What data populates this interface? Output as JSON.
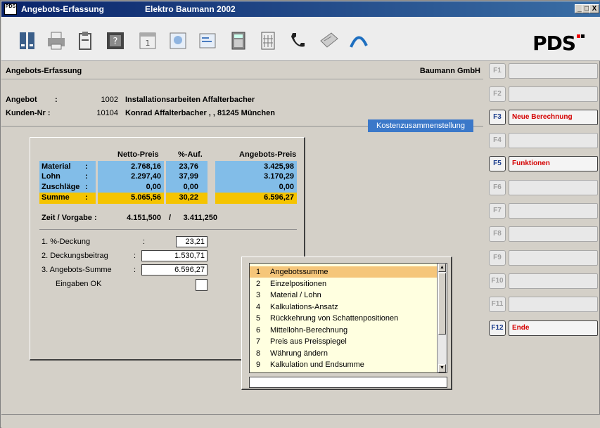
{
  "window": {
    "title": "Angebots-Erfassung",
    "app_name": "Elektro Baumann 2002",
    "app_icon_text": "PDS",
    "buttons": [
      "_",
      "□",
      "X"
    ]
  },
  "toolbar": {
    "icons": [
      "binder-icon",
      "printer-icon",
      "document-icon",
      "help-icon",
      "calendar-icon",
      "image-icon",
      "card-icon",
      "calculator-icon",
      "grid-icon",
      "phone-icon",
      "mail-icon",
      "arc-icon"
    ],
    "logo": "PDS"
  },
  "header": {
    "left": "Angebots-Erfassung",
    "right": "Baumann GmbH"
  },
  "offer": {
    "angebot_label": "Angebot",
    "angebot_colon": ":",
    "angebot_nr": "1002",
    "angebot_text": "Installationsarbeiten Affalterbacher",
    "kunden_label": "Kunden-Nr :",
    "kunden_nr": "10104",
    "kunden_text": "Konrad Affalterbacher , , 81245 München"
  },
  "kosten_tab": "Kostenzusammenstellung",
  "costs": {
    "headers": {
      "netto": "Netto-Preis",
      "auf": "%-Auf.",
      "angebot": "Angebots-Preis"
    },
    "rows": [
      {
        "label": "Material",
        "colon": ":",
        "netto": "2.768,16",
        "auf": "23,76",
        "angebot": "3.425,98"
      },
      {
        "label": "Lohn",
        "colon": ":",
        "netto": "2.297,40",
        "auf": "37,99",
        "angebot": "3.170,29"
      },
      {
        "label": "Zuschläge",
        "colon": ":",
        "netto": "0,00",
        "auf": "0,00",
        "angebot": "0,00"
      }
    ],
    "summe": {
      "label": "Summe",
      "colon": ":",
      "netto": "5.065,56",
      "auf": "30,22",
      "angebot": "6.596,27"
    },
    "zeit_label": "Zeit / Vorgabe :",
    "zeit_value": "4.151,500",
    "zeit_sep": "/",
    "vorgabe_value": "3.411,250"
  },
  "inputs": [
    {
      "label": "1.  %-Deckung",
      "colon": ":",
      "value": "23,21"
    },
    {
      "label": "2.  Deckungsbeitrag",
      "colon": ":",
      "value": "1.530,71"
    },
    {
      "label": "3.  Angebots-Summe",
      "colon": ":",
      "value": "6.596,27"
    }
  ],
  "eingaben_ok": "Eingaben OK",
  "fkeys": [
    {
      "key": "F1",
      "label": ""
    },
    {
      "key": "F2",
      "label": ""
    },
    {
      "key": "F3",
      "label": "Neue Berechnung"
    },
    {
      "key": "F4",
      "label": ""
    },
    {
      "key": "F5",
      "label": "Funktionen"
    },
    {
      "key": "F6",
      "label": ""
    },
    {
      "key": "F7",
      "label": ""
    },
    {
      "key": "F8",
      "label": ""
    },
    {
      "key": "F9",
      "label": ""
    },
    {
      "key": "F10",
      "label": ""
    },
    {
      "key": "F11",
      "label": ""
    },
    {
      "key": "F12",
      "label": "Ende"
    }
  ],
  "popup": {
    "items": [
      {
        "n": "1",
        "t": "Angebotssumme"
      },
      {
        "n": "2",
        "t": "Einzelpositionen"
      },
      {
        "n": "3",
        "t": "Material / Lohn"
      },
      {
        "n": "4",
        "t": "Kalkulations-Ansatz"
      },
      {
        "n": "5",
        "t": "Rückkehrung von Schattenpositionen"
      },
      {
        "n": "6",
        "t": "Mittellohn-Berechnung"
      },
      {
        "n": "7",
        "t": "Preis aus Preisspiegel"
      },
      {
        "n": "8",
        "t": "Währung ändern"
      },
      {
        "n": "9",
        "t": "Kalkulation und Endsumme"
      }
    ]
  },
  "colors": {
    "blue": "#82bde8",
    "yellow": "#f5c400",
    "red": "#d40000",
    "tab": "#3b78c9"
  }
}
